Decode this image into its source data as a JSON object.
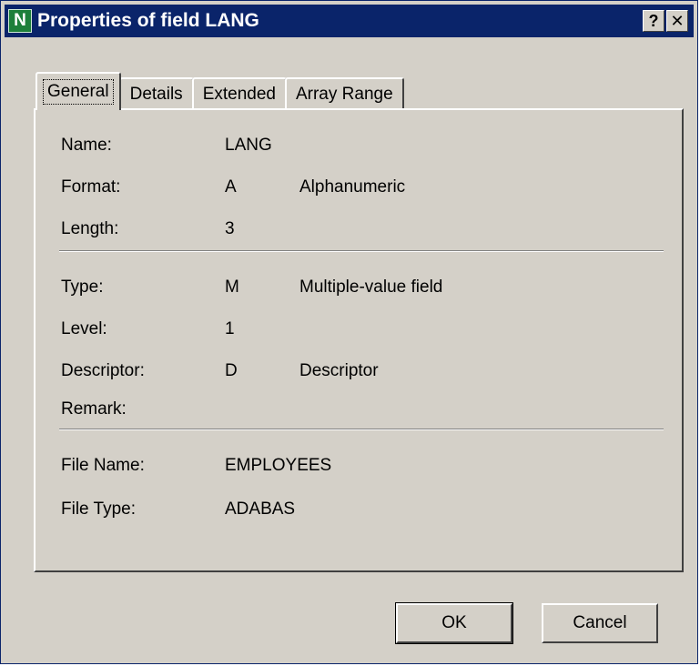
{
  "window": {
    "app_icon_glyph": "N",
    "title": "Properties of field LANG",
    "help_button": "?",
    "close_button": "✕",
    "colors": {
      "titlebar": "#0a246a",
      "face": "#d4d0c8",
      "icon": "#1d7f3a"
    }
  },
  "tabs": [
    {
      "label": "General",
      "active": true
    },
    {
      "label": "Details",
      "active": false
    },
    {
      "label": "Extended",
      "active": false
    },
    {
      "label": "Array Range",
      "active": false
    }
  ],
  "general": {
    "name": {
      "label": "Name:",
      "value": "LANG"
    },
    "format": {
      "label": "Format:",
      "value": "A",
      "description": "Alphanumeric"
    },
    "length": {
      "label": "Length:",
      "value": "3"
    },
    "type": {
      "label": "Type:",
      "value": "M",
      "description": "Multiple-value field"
    },
    "level": {
      "label": "Level:",
      "value": "1"
    },
    "descriptor": {
      "label": "Descriptor:",
      "value": "D",
      "description": "Descriptor"
    },
    "remark": {
      "label": "Remark:",
      "value": ""
    },
    "file_name": {
      "label": "File Name:",
      "value": "EMPLOYEES"
    },
    "file_type": {
      "label": "File Type:",
      "value": "ADABAS"
    }
  },
  "buttons": {
    "ok": "OK",
    "cancel": "Cancel"
  }
}
